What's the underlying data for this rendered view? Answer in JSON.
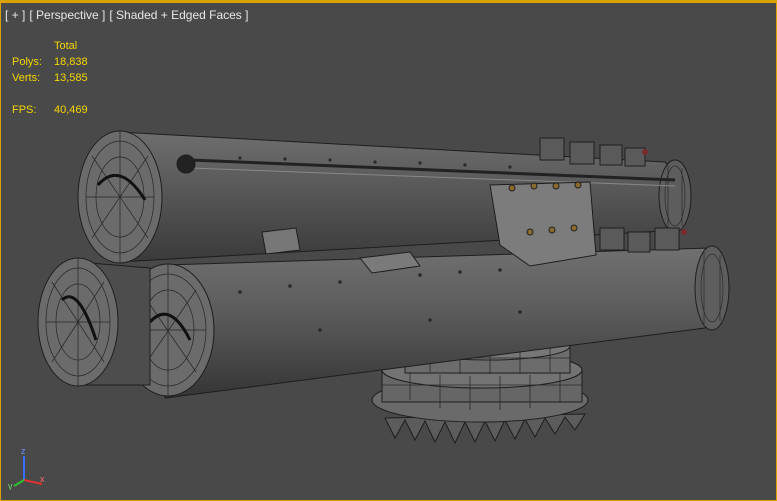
{
  "viewport": {
    "menu_label": "[ + ]",
    "view_label": "[ Perspective ]",
    "shading_label": "[ Shaded + Edged Faces ]"
  },
  "stats": {
    "header": "Total",
    "polys_label": "Polys:",
    "polys_value": "18,838",
    "verts_label": "Verts:",
    "verts_value": "13,585",
    "fps_label": "FPS:",
    "fps_value": "40,469"
  },
  "gizmo": {
    "z_label": "z",
    "x_label": "x",
    "y_label": "y"
  },
  "colors": {
    "viewport_bg": "#494949",
    "active_border": "#d9a200",
    "stats_text": "#f4d600",
    "label_text": "#e8e8e8"
  }
}
